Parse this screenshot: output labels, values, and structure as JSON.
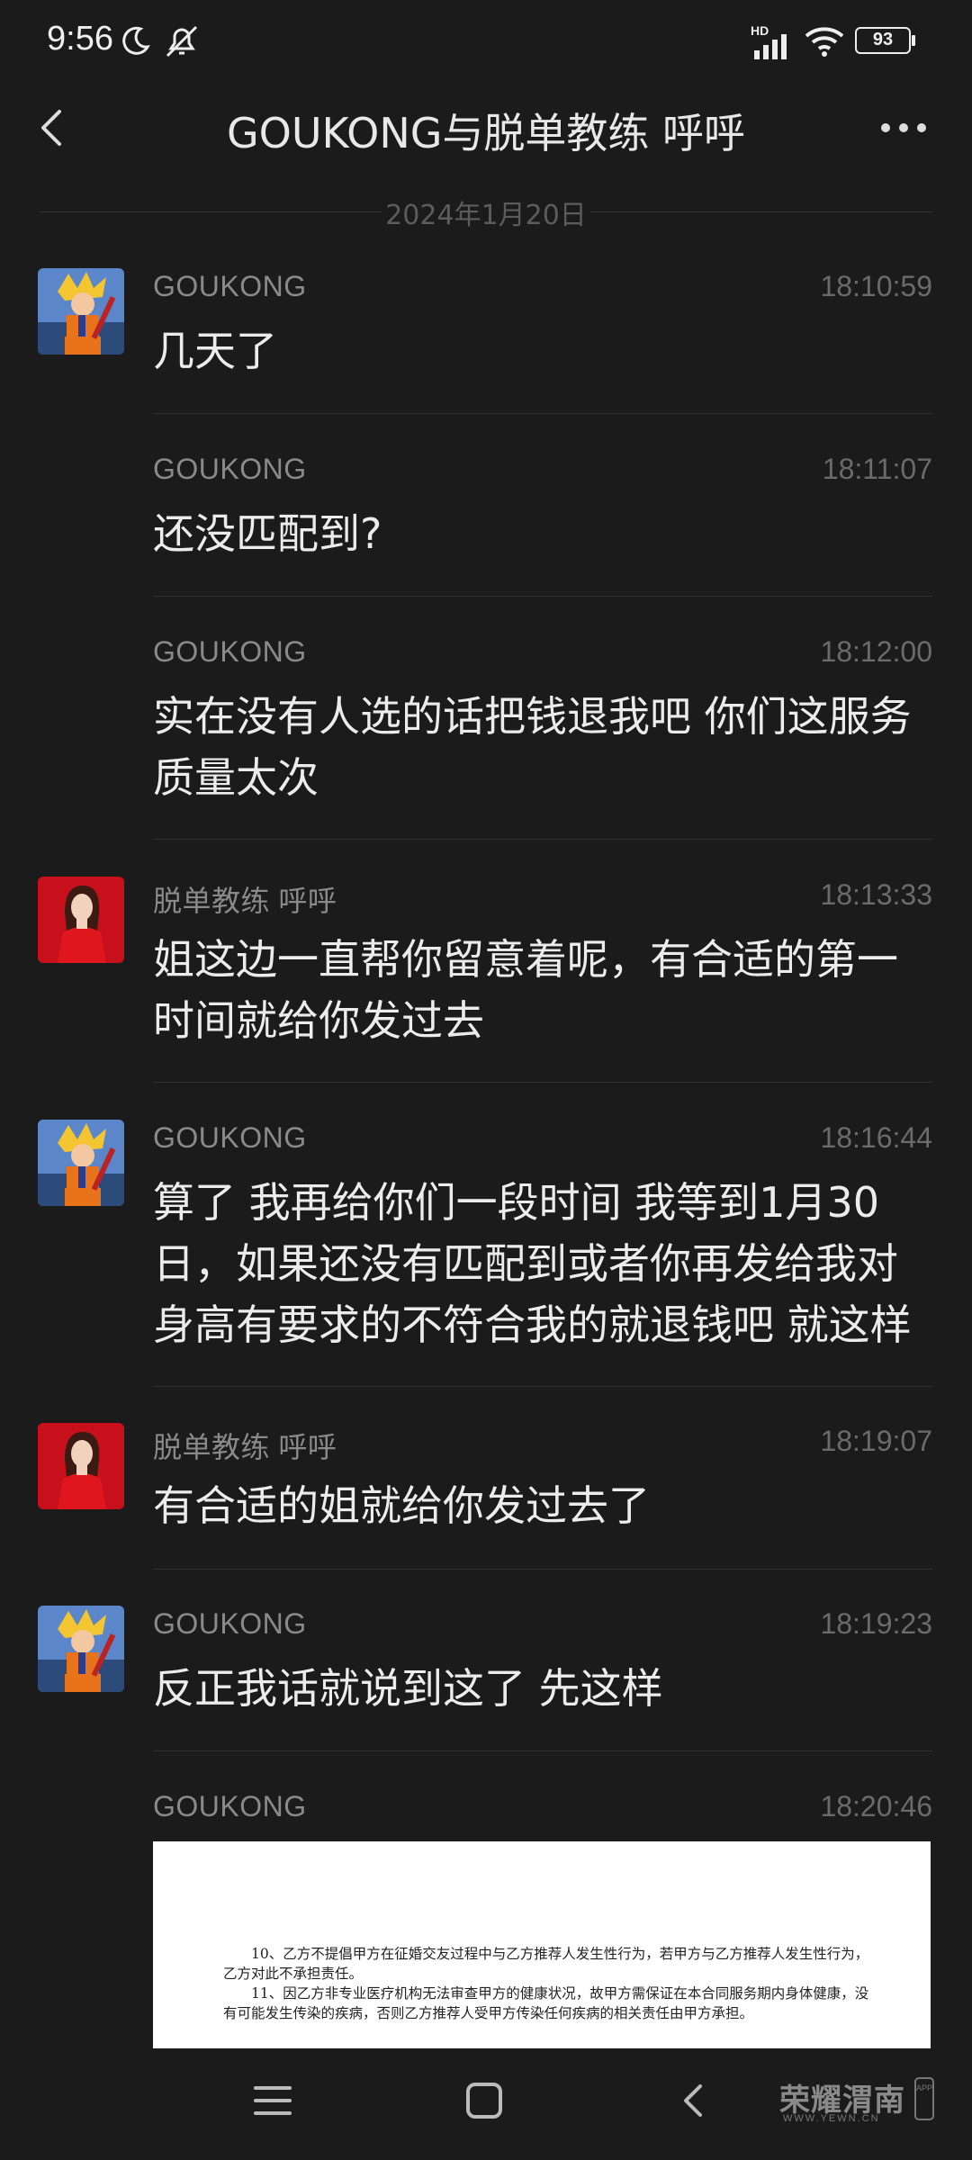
{
  "status_bar": {
    "time": "9:56",
    "battery": "93",
    "network_badge": "HD",
    "icons": [
      "moon-icon",
      "mute-bell-icon",
      "signal-icon",
      "wifi-icon",
      "battery-icon"
    ]
  },
  "header": {
    "title": "GOUKONG与脱单教练  呼呼",
    "back_icon": "back-chevron-icon",
    "more_icon": "more-dots-icon"
  },
  "date_divider": "2024年1月20日",
  "messages": [
    {
      "sender": "GOUKONG",
      "time": "18:10:59",
      "text": "几天了",
      "avatar": "goku-avatar"
    },
    {
      "sender": "GOUKONG",
      "time": "18:11:07",
      "text": "还没匹配到?"
    },
    {
      "sender": "GOUKONG",
      "time": "18:12:00",
      "text": "实在没有人选的话把钱退我吧 你们这服务质量太次"
    },
    {
      "sender": "脱单教练  呼呼",
      "time": "18:13:33",
      "text": "姐这边一直帮你留意着呢，有合适的第一时间就给你发过去",
      "avatar": "coach-avatar"
    },
    {
      "sender": "GOUKONG",
      "time": "18:16:44",
      "text": "算了 我再给你们一段时间 我等到1月30日，如果还没有匹配到或者你再发给我对身高有要求的不符合我的就退钱吧 就这样",
      "avatar": "goku-avatar"
    },
    {
      "sender": "脱单教练  呼呼",
      "time": "18:19:07",
      "text": "有合适的姐就给你发过去了",
      "avatar": "coach-avatar"
    },
    {
      "sender": "GOUKONG",
      "time": "18:19:23",
      "text": "反正我话就说到这了 先这样",
      "avatar": "goku-avatar"
    },
    {
      "sender": "GOUKONG",
      "time": "18:20:46",
      "text": ""
    }
  ],
  "attachment": {
    "paragraphs": [
      "10、乙方不提倡甲方在征婚交友过程中与乙方推荐人发生性行为，若甲方与乙方推荐人发生性行为，乙方对此不承担责任。",
      "11、因乙方非专业医疗机构无法审查甲方的健康状况，故甲方需保证在本合同服务期内身体健康，没有可能发生传染的疾病，否则乙方推荐人受甲方传染任何疾病的相关责任由甲方承担。"
    ]
  },
  "nav_bar": {
    "icons": [
      "menu-icon",
      "home-square-icon",
      "back-triangle-icon"
    ],
    "watermark": {
      "main": "荣耀渭南",
      "sub": "WWW.YEWN.CN",
      "app": "APP"
    }
  },
  "colors": {
    "background": "#1b1b1b",
    "text_primary": "#ececec",
    "text_secondary": "#8a8a8a",
    "time_text": "#6b6b6b",
    "coach_avatar_red": "#c8101c"
  }
}
